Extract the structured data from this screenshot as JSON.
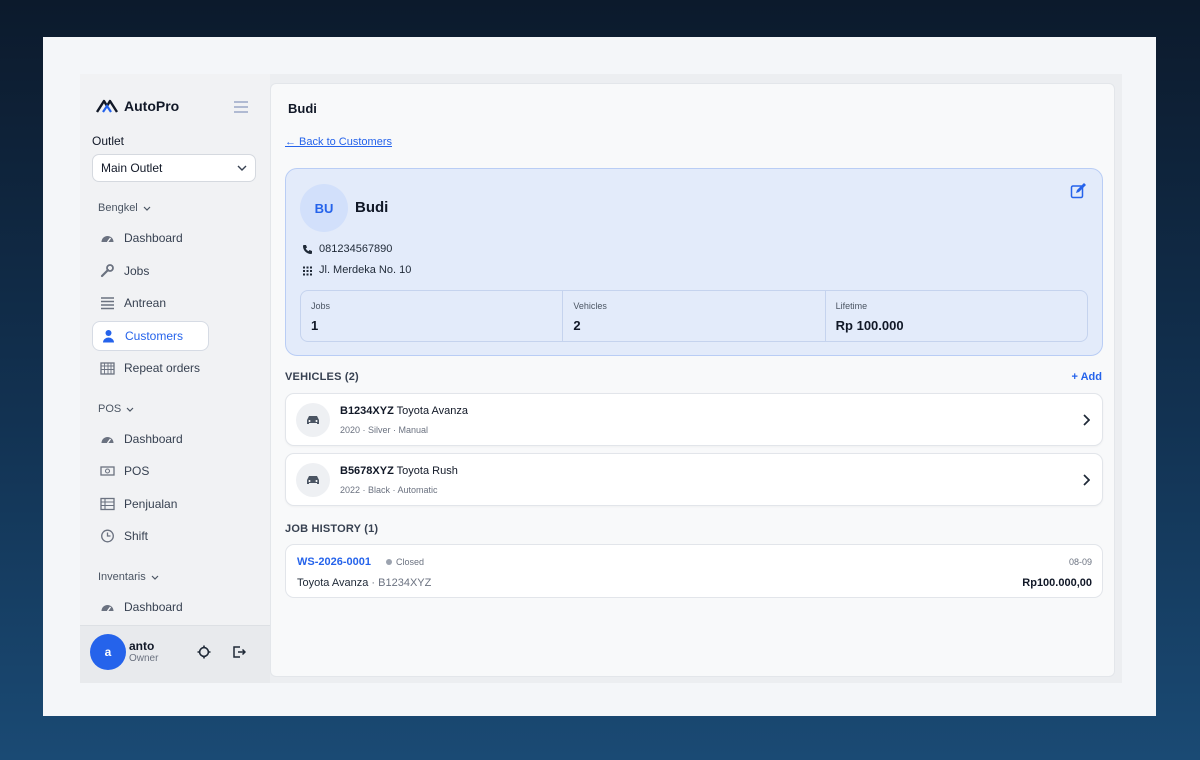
{
  "brand": {
    "name": "AutoPro"
  },
  "outlet": {
    "label": "Outlet",
    "selected": "Main Outlet"
  },
  "sidebar": {
    "sections": [
      {
        "title": "Bengkel",
        "items": [
          {
            "label": "Dashboard",
            "icon": "gauge-icon"
          },
          {
            "label": "Jobs",
            "icon": "wrench-icon"
          },
          {
            "label": "Antrean",
            "icon": "list-icon"
          },
          {
            "label": "Customers",
            "icon": "user-icon",
            "active": true
          },
          {
            "label": "Repeat orders",
            "icon": "calendar-icon"
          }
        ]
      },
      {
        "title": "POS",
        "items": [
          {
            "label": "Dashboard",
            "icon": "gauge-icon"
          },
          {
            "label": "POS",
            "icon": "cash-icon"
          },
          {
            "label": "Penjualan",
            "icon": "table-icon"
          },
          {
            "label": "Shift",
            "icon": "clock-icon"
          }
        ]
      },
      {
        "title": "Inventaris",
        "items": [
          {
            "label": "Dashboard",
            "icon": "gauge-icon"
          }
        ]
      }
    ]
  },
  "user": {
    "initial": "a",
    "name": "anto",
    "role": "Owner"
  },
  "page": {
    "title": "Budi",
    "back_link": "← Back to Customers"
  },
  "customer": {
    "initials": "BU",
    "name": "Budi",
    "phone": "081234567890",
    "address": "Jl. Merdeka No. 10",
    "stats": [
      {
        "label": "Jobs",
        "value": "1"
      },
      {
        "label": "Vehicles",
        "value": "2"
      },
      {
        "label": "Lifetime",
        "value": "Rp 100.000"
      }
    ]
  },
  "vehicles": {
    "title": "VEHICLES (2)",
    "add_label": "+ Add",
    "items": [
      {
        "plate": "B1234XYZ",
        "model": "Toyota Avanza",
        "meta": "2020 · Silver · Manual"
      },
      {
        "plate": "B5678XYZ",
        "model": "Toyota Rush",
        "meta": "2022 · Black · Automatic"
      }
    ]
  },
  "job_history": {
    "title": "JOB HISTORY (1)",
    "items": [
      {
        "id": "WS-2026-0001",
        "status": "Closed",
        "date": "08-09",
        "vehicle": "Toyota Avanza",
        "plate": "B1234XYZ",
        "amount": "Rp100.000,00"
      }
    ]
  },
  "colors": {
    "accent": "#2563eb",
    "profile_bg": "#e3ebfa",
    "sidebar_bg": "#f1f2f4"
  }
}
